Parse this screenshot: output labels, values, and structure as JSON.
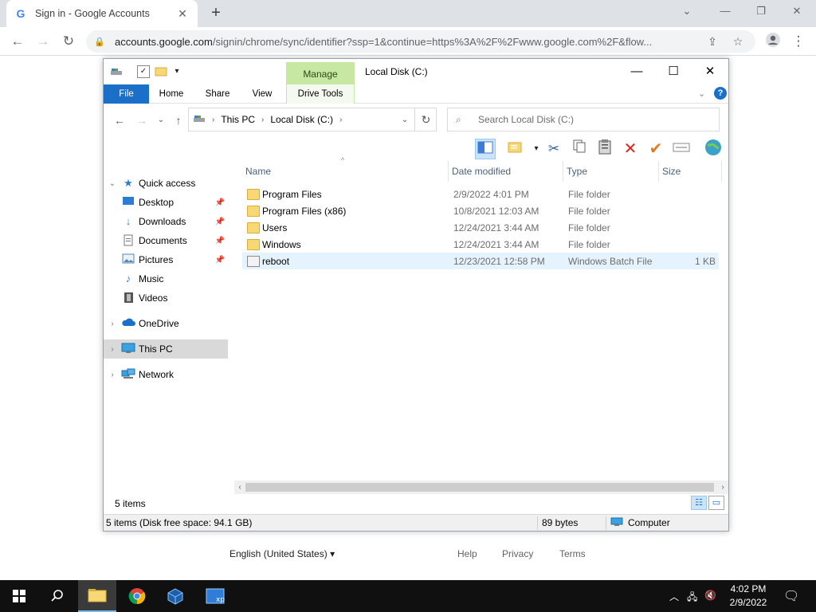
{
  "browser": {
    "tab_title": "Sign in - Google Accounts",
    "tab_close": "✕",
    "new_tab": "+",
    "url_host": "accounts.google.com",
    "url_rest": "/signin/chrome/sync/identifier?ssp=1&continue=https%3A%2F%2Fwww.google.com%2F&flow..."
  },
  "page": {
    "language": "English (United States)",
    "links": [
      "Help",
      "Privacy",
      "Terms"
    ]
  },
  "explorer": {
    "quick_access_label": "Manage",
    "window_title": "Local Disk (C:)",
    "ribbon_tabs": [
      "File",
      "Home",
      "Share",
      "View",
      "Drive Tools"
    ],
    "help": "?",
    "breadcrumb": [
      "This PC",
      "Local Disk (C:)"
    ],
    "search_placeholder": "Search Local Disk (C:)",
    "nav": {
      "quick_access": "Quick access",
      "desktop": "Desktop",
      "downloads": "Downloads",
      "documents": "Documents",
      "pictures": "Pictures",
      "music": "Music",
      "videos": "Videos",
      "onedrive": "OneDrive",
      "this_pc": "This PC",
      "network": "Network"
    },
    "columns": {
      "name": "Name",
      "date": "Date modified",
      "type": "Type",
      "size": "Size"
    },
    "files": [
      {
        "name": "Program Files",
        "date": "2/9/2022 4:01 PM",
        "type": "File folder",
        "size": ""
      },
      {
        "name": "Program Files (x86)",
        "date": "10/8/2021 12:03 AM",
        "type": "File folder",
        "size": ""
      },
      {
        "name": "Users",
        "date": "12/24/2021 3:44 AM",
        "type": "File folder",
        "size": ""
      },
      {
        "name": "Windows",
        "date": "12/24/2021 3:44 AM",
        "type": "File folder",
        "size": ""
      },
      {
        "name": "reboot",
        "date": "12/23/2021 12:58 PM",
        "type": "Windows Batch File",
        "size": "1 KB"
      }
    ],
    "item_count": "5 items",
    "status": {
      "summary": "5 items (Disk free space: 94.1 GB)",
      "bytes": "89 bytes",
      "location": "Computer"
    }
  },
  "taskbar": {
    "time": "4:02 PM",
    "date": "2/9/2022"
  }
}
